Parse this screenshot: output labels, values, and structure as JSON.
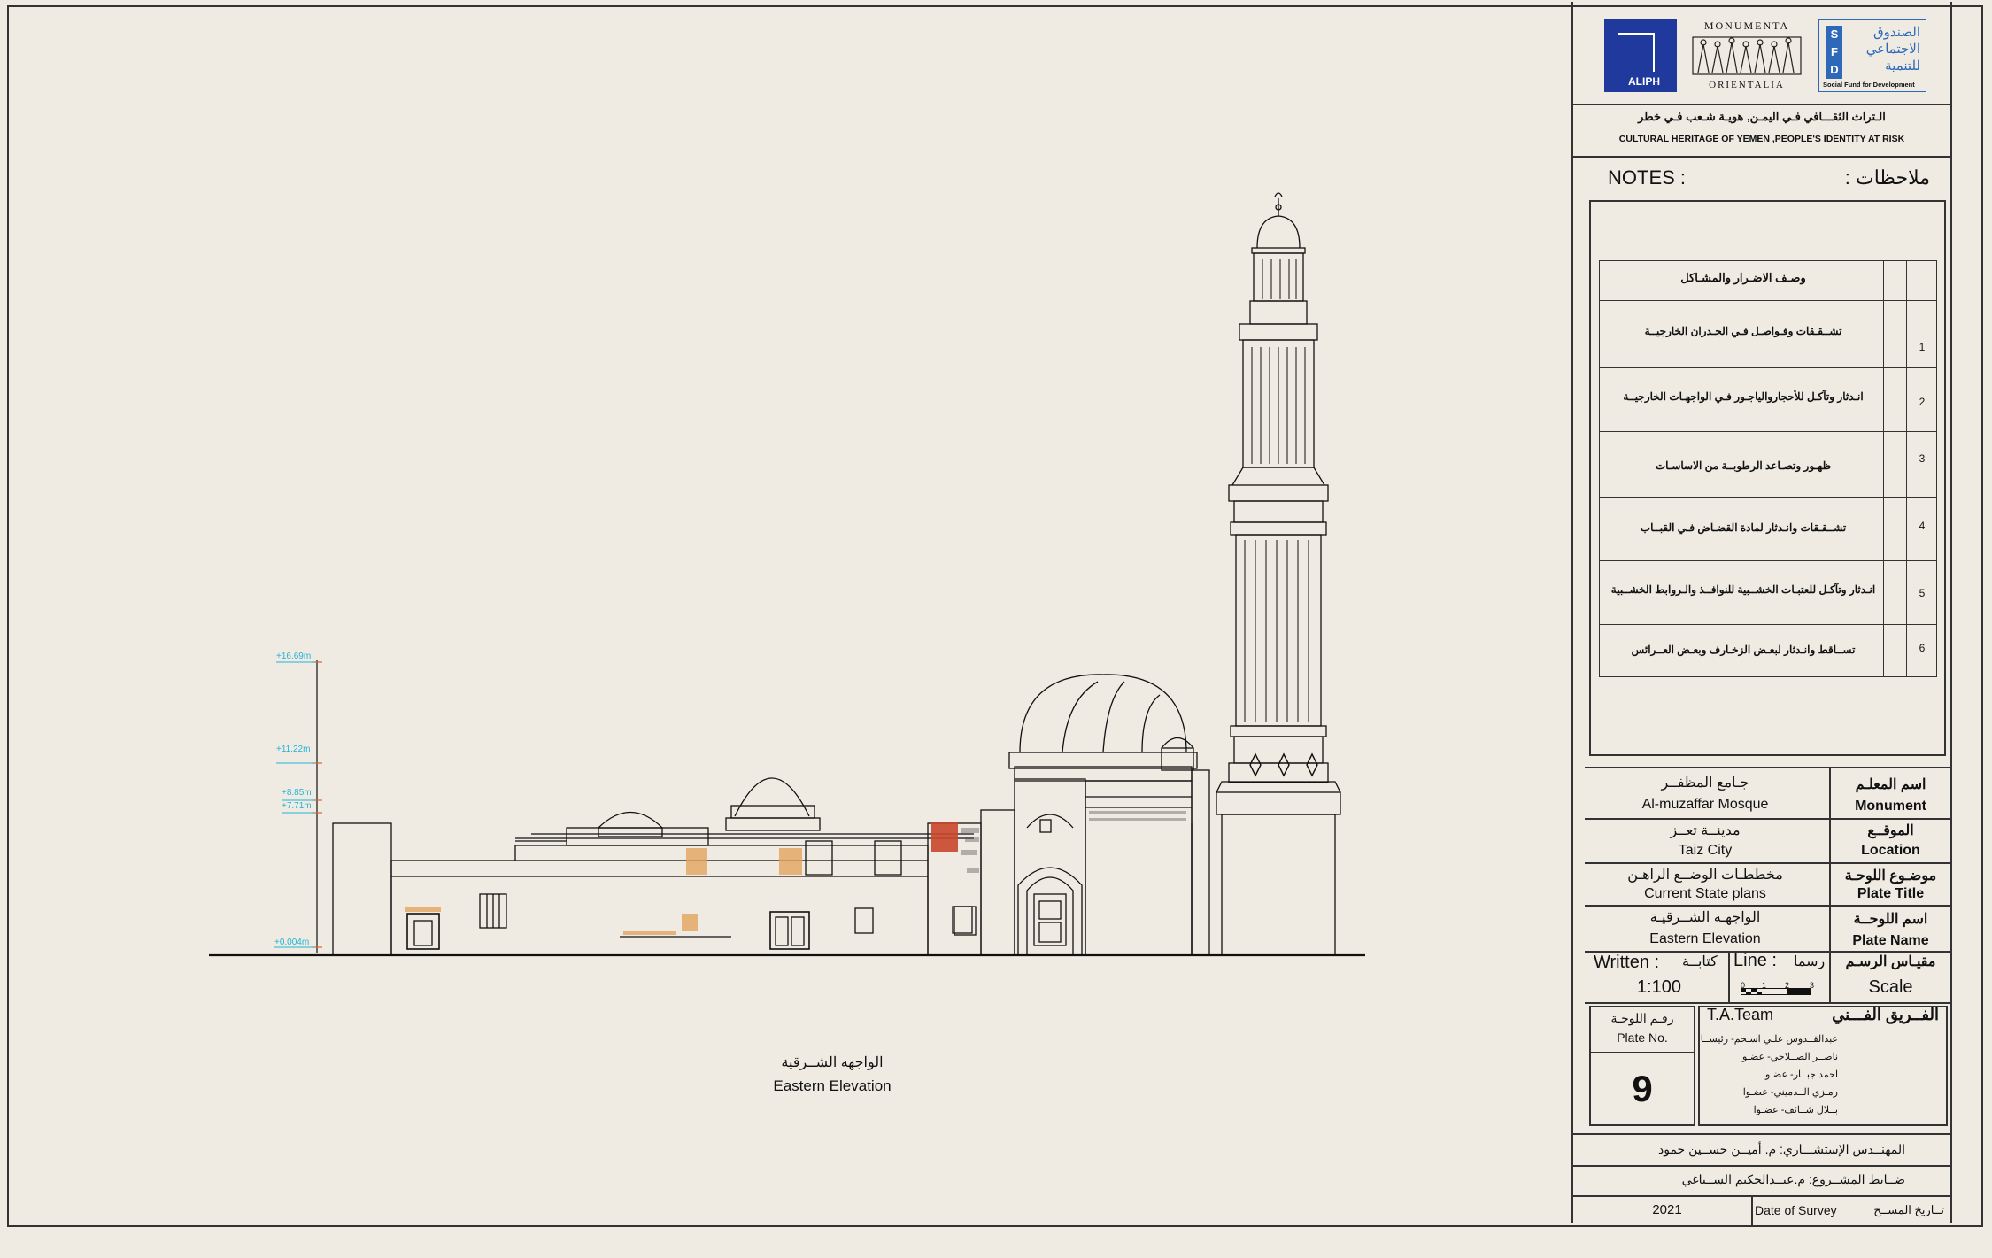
{
  "logos": {
    "aliph": "ALIPH",
    "monumenta_top": "MONUMENTA",
    "monumenta_bottom": "ORIENTALIA",
    "sfd_arabic_1": "الصندوق",
    "sfd_arabic_2": "الاجتماعي",
    "sfd_arabic_3": "للتنمية",
    "sfd_letters": [
      "S",
      "F",
      "D"
    ],
    "sfd_english": "Social Fund for Development"
  },
  "project": {
    "title_ar": "الـتراث الثقـــافي فـي اليمـن, هويـة شـعب فـي خطر",
    "title_en": "CULTURAL HERITAGE OF YEMEN ,PEOPLE'S IDENTITY AT RISK"
  },
  "notes": {
    "label_en": "NOTES :",
    "label_ar": "ملاحظات :",
    "table_header": "وصـف الاضـرار والمشـاكل",
    "items": [
      {
        "num": "1",
        "text": "تشــقـقات  وفـواصـل فـي الجـدران الخارجيــة"
      },
      {
        "num": "2",
        "text": "انـدثار وتآكـل للأحجاروالياجـور فـي الواجهـات الخارجيــة"
      },
      {
        "num": "3",
        "text": "ظهـور وتصـاعد الرطوبــة  من الاساسـات"
      },
      {
        "num": "4",
        "text": "تشــقـقات    وانـدثار لمادة القضـاض فـي القبــاب"
      },
      {
        "num": "5",
        "text": "انـدثار وتآكـل للعتبـات الخشــبية للنوافــذ والـروابط الخشــبية"
      },
      {
        "num": "6",
        "text": "تســاقط وانـدثار لبعـض  الزخـارف وبعـض العــرائس"
      }
    ]
  },
  "info": {
    "monument_label_ar": "اسم المعلـم",
    "monument_label_en": "Monument",
    "monument_value_ar": "جـامع المظفــر",
    "monument_value_en": "Al-muzaffar Mosque",
    "location_label_ar": "الموقــع",
    "location_label_en": "Location",
    "location_value_ar": "مدينــة تعــز",
    "location_value_en": "Taiz City",
    "plate_title_label_ar": "موضـوع اللوحـة",
    "plate_title_label_en": "Plate Title",
    "plate_title_value_ar": "مخططـات الوضــع الراهـن",
    "plate_title_value_en": "Current State plans",
    "plate_name_label_ar": "اسم اللوحــة",
    "plate_name_label_en": "Plate Name",
    "plate_name_value_ar": "الواجهـه الشــرقيـة",
    "plate_name_value_en": "Eastern Elevation",
    "scale_label_ar": "مقيـاس الرسـم",
    "scale_label_en": "Scale",
    "written_en": "Written :",
    "written_ar": "كتابــة",
    "line_en": "Line :",
    "line_ar": "رسما",
    "scale_value": "1:100",
    "scale_bar_ticks": [
      "0",
      "1",
      "2",
      "3"
    ],
    "plate_no_ar": "رقـم اللوحـة",
    "plate_no_en": "Plate No.",
    "plate_no_value": "9",
    "team_en": "T.A.Team",
    "team_ar": "الفــريق الفـــني",
    "team_members": [
      "عبدالقــدوس علـي اسـحم- رئيســا",
      "ناصــر الصــلاحي- عضـوا",
      "احمد جبــار- عضـوا",
      "رمـزي الــدميني- عضـوا",
      "بــلال شــائف- عضـوا"
    ],
    "consultant": "المهنــدس الإستشـــاري: م. أميــن حســين حمود",
    "controller": "ضــابط المشــروع: م.عبــدالحكيم الســياغي",
    "survey_year": "2021",
    "survey_label_en": "Date of Survey",
    "survey_label_ar": "تــاريخ المســح"
  },
  "elevation": {
    "levels": [
      "+16.69m",
      "+11.22m",
      "+8.85m",
      "+7.71m",
      "+0.004m"
    ],
    "caption_ar": "الواجهه الشــرقية",
    "caption_en": "Eastern Elevation"
  },
  "colors": {
    "paper": "#efebe3",
    "ink": "#111111",
    "level_cyan": "#21b4d6",
    "level_marker": "#e0602c",
    "brick_red": "#c8472b",
    "window_orange": "#e2a45e",
    "aliph_blue": "#1f3a9c",
    "sfd_blue": "#2d69b8"
  }
}
